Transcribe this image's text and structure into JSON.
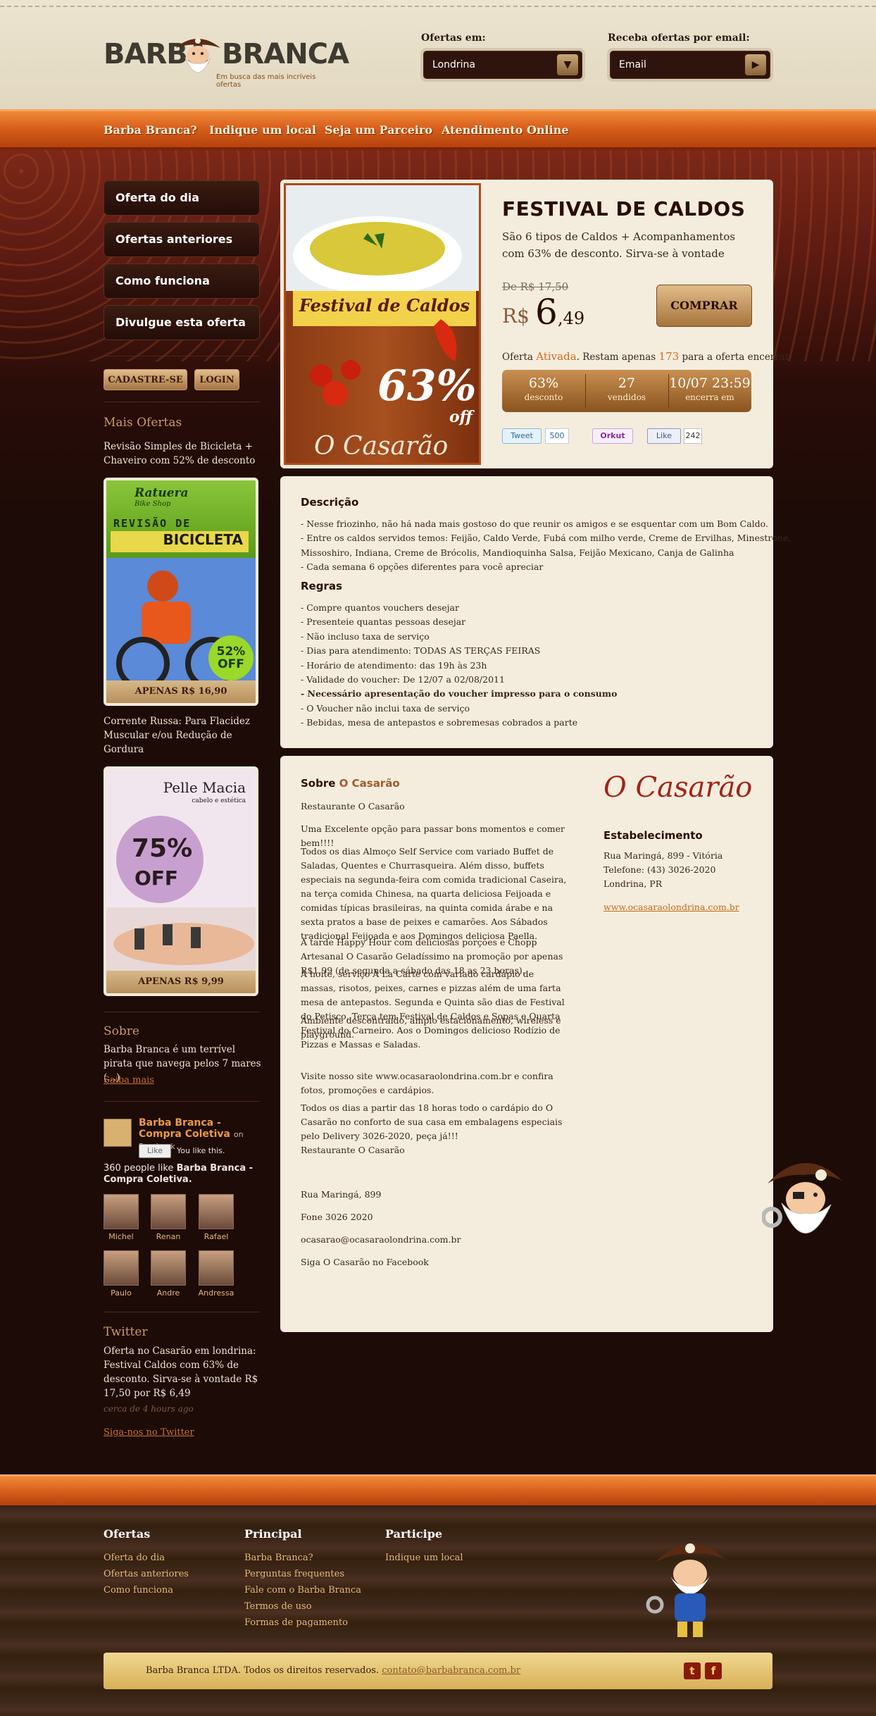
{
  "header": {
    "logo_word1": "BARBA",
    "logo_word2": "BRANCA",
    "tagline": "Em busca das mais incríveis ofertas",
    "offers_in_label": "Ofertas em:",
    "city_selected": "Londrina",
    "email_label": "Receba ofertas por email:",
    "email_placeholder": "Email"
  },
  "nav": [
    "Barba Branca?",
    "Indique um local",
    "Seja um Parceiro",
    "Atendimento Online"
  ],
  "sidebar": {
    "buttons": [
      "Oferta do dia",
      "Ofertas anteriores",
      "Como funciona",
      "Divulgue esta oferta"
    ],
    "signup": "CADASTRE-SE",
    "login": "LOGIN",
    "more_title": "Mais Ofertas",
    "offers": [
      {
        "title": "Revisão Simples de Bicicleta + Chaveiro com 52% de desconto",
        "price": "APENAS R$ 16,90",
        "img_brand": "Ratuera",
        "img_sub": "Bike Shop",
        "img_head1": "REVISÃO DE",
        "img_head2": "BICICLETA",
        "img_badge": "52% OFF"
      },
      {
        "title": "Corrente Russa: Para Flacidez Muscular e/ou Redução de Gordura",
        "price": "APENAS R$ 9,99",
        "img_brand": "Pelle Macia",
        "img_sub": "cabelo e estética",
        "img_pct": "75%",
        "img_off": "OFF"
      }
    ],
    "about_title": "Sobre",
    "about_text": "Barba Branca é um terrível pirata que navega pelos 7 mares (...)",
    "about_link": "Saiba mais",
    "facebook": {
      "name": "Barba Branca - Compra Coletiva",
      "on": "on Facebook",
      "like_btn": "Like",
      "you_like": "You like this.",
      "count_text": "360 people like",
      "count_name": "Barba Branca - Compra Coletiva.",
      "fans": [
        "Michel",
        "Renan",
        "Rafael",
        "Paulo",
        "Andre",
        "Andressa"
      ]
    },
    "twitter_title": "Twitter",
    "tweet": "Oferta no Casarão em londrina: Festival Caldos com 63% de desconto. Sirva-se à vontade R$ 17,50 por R$ 6,49",
    "tweet_time": "cerca de 4 hours ago",
    "twitter_link": "Siga-nos no Twitter"
  },
  "deal": {
    "img_title": "Festival de Caldos",
    "img_pct": "63%",
    "img_off": "off",
    "img_brand": "O Casarão",
    "title": "FESTIVAL DE CALDOS",
    "description": "São 6 tipos de Caldos + Acompanhamentos com 63% de desconto. Sirva-se à vontade",
    "old_price": "De R$ 17,50",
    "currency": "R$",
    "price_int": "6",
    "price_dec": ",49",
    "buy": "COMPRAR",
    "status_pre": "Oferta",
    "status_word": "Ativada",
    "status_mid": ". Restam apenas",
    "status_count": "173",
    "status_post": "para a oferta encerrar.",
    "stats": [
      {
        "value": "63%",
        "label": "desconto"
      },
      {
        "value": "27",
        "label": "vendidos"
      },
      {
        "value": "10/07 23:59",
        "label": "encerra em"
      }
    ],
    "share": {
      "tweet": "Tweet",
      "tweet_count": "500",
      "orkut": "Orkut",
      "like": "Like",
      "like_count": "242"
    }
  },
  "details": {
    "desc_title": "Descrição",
    "desc_lines": [
      "- Nesse friozinho, não há nada mais gostoso do que reunir os amigos e se esquentar com um Bom Caldo.",
      "- Entre os caldos servidos temos: Feijão, Caldo Verde, Fubá com milho verde, Creme de Ervilhas, Minestrone,",
      "Missoshiro, Indiana, Creme de Brócolis, Mandioquinha Salsa, Feijão Mexicano, Canja de Galinha",
      "- Cada semana 6 opções diferentes para você apreciar"
    ],
    "rules_title": "Regras",
    "rules_lines": [
      "- Compre quantos vouchers desejar",
      "- Presenteie quantas pessoas desejar",
      "- Não incluso taxa de serviço",
      "- Dias para atendimento: TODAS AS TERÇAS FEIRAS",
      "- Horário de atendimento: das 19h às 23h",
      "- Validade do voucher: De 12/07 a 02/08/2011",
      "- Necessário apresentação do voucher impresso para o consumo",
      "- O Voucher não inclui taxa de serviço",
      "- Bebidas, mesa de antepastos e sobremesas cobrados a parte"
    ]
  },
  "about": {
    "title_pre": "Sobre",
    "title_name": "O Casarão",
    "paragraphs": [
      "Restaurante O Casarão",
      "Uma Excelente opção para passar bons momentos e comer bem!!!!",
      "Todos os dias Almoço Self Service com variado Buffet de Saladas, Quentes e Churrasqueira. Além disso, buffets especiais na segunda-feira com comida tradicional Caseira, na terça comida Chinesa, na quarta deliciosa Feijoada e comidas típicas brasileiras, na quinta comida árabe e na sexta pratos a base de peixes e camarões. Aos Sábados tradicional Feijoada e aos Domingos deliciosa Paella.",
      "À tarde Happy Hour com deliciosas porções e Chopp Artesanal O Casarão Geladíssimo na promoção por apenas R$1,99 (de segunda a sábado das 18 as 23 horas).",
      "À noite, serviço À La Carte com variado cardápio de massas, risotos, peixes, carnes e pizzas além de uma farta mesa de antepastos. Segunda e Quinta são dias de Festival do Petisco, Terça tem Festival de Caldos e Sopas e Quarta Festival do Carneiro. Aos o Domingos delicioso Rodízio de Pizzas e Massas e Saladas.",
      "Ambiente descontraído, amplo estacionamento, wireless e playground.",
      "Visite nosso site www.ocasaraolondrina.com.br e confira fotos, promoções e cardápios.",
      "Todos os dias a partir das 18 horas todo o cardápio do O Casarão no conforto de sua casa em embalagens especiais pelo Delivery 3026-2020, peça já!!!",
      "Restaurante O Casarão",
      "Rua Maringá, 899",
      "Fone 3026 2020",
      "ocasarao@ocasaraolondrina.com.br",
      "Siga O Casarão no Facebook"
    ],
    "logo": "O Casarão",
    "est_title": "Estabelecimento",
    "address": "Rua Maringá, 899 - Vitória",
    "phone": "Telefone: (43) 3026-2020",
    "city": "Londrina, PR",
    "site": "www.ocasaraolondrina.com.br"
  },
  "footer": {
    "col1_title": "Ofertas",
    "col1": [
      "Oferta do dia",
      "Ofertas anteriores",
      "Como funciona"
    ],
    "col2_title": "Principal",
    "col2": [
      "Barba Branca?",
      "Perguntas frequentes",
      "Fale com o Barba Branca",
      "Termos de uso",
      "Formas de pagamento"
    ],
    "col3_title": "Participe",
    "col3": [
      "Indique um local"
    ],
    "copyright": "Barba Branca LTDA. Todos os direitos reservados.",
    "email": "contato@barbabranca.com.br",
    "social": [
      "t",
      "f"
    ]
  }
}
